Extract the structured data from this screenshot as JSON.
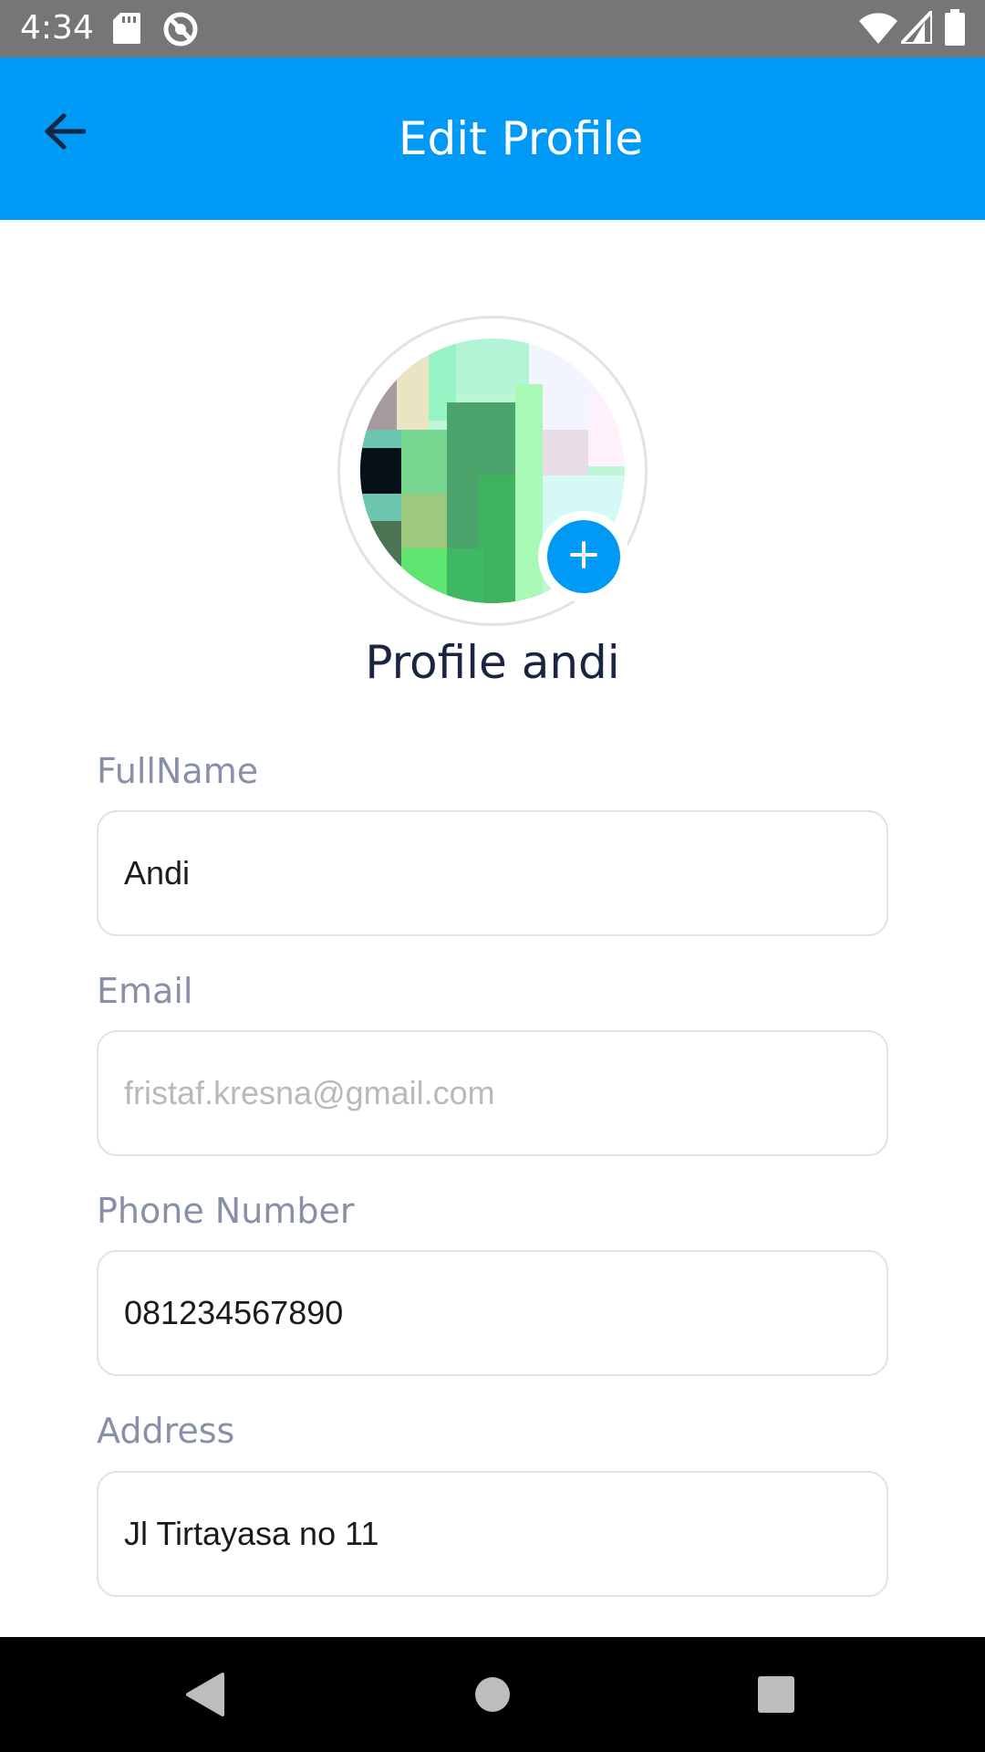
{
  "status_bar": {
    "time": "4:34",
    "icons": [
      "sd-card-icon",
      "sync-disabled-icon",
      "wifi-icon",
      "cellular-signal-icon",
      "battery-icon"
    ]
  },
  "app_bar": {
    "title": "Edit Profile",
    "back_icon": "arrow-left-icon",
    "color": "#0099f5"
  },
  "profile": {
    "name": "Profile andi",
    "add_photo_icon": "plus-icon"
  },
  "form": {
    "fullname": {
      "label": "FullName",
      "value": "Andi"
    },
    "email": {
      "label": "Email",
      "value": "",
      "placeholder": "fristaf.kresna@gmail.com"
    },
    "phone": {
      "label": "Phone Number",
      "value": "081234567890"
    },
    "address": {
      "label": "Address",
      "value": "Jl Tirtayasa no 11"
    }
  },
  "nav_bar": {
    "icons": [
      "back-triangle-icon",
      "home-circle-icon",
      "recents-square-icon"
    ]
  }
}
